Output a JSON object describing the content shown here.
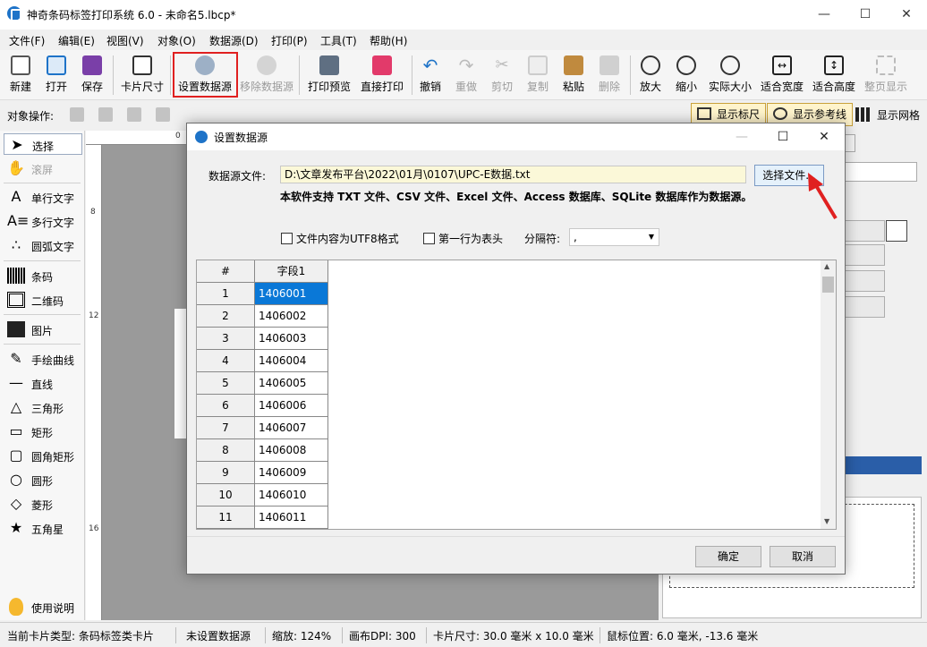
{
  "window": {
    "title": "神奇条码标签打印系统 6.0 - 未命名5.lbcp*",
    "minimize": "—",
    "maximize": "☐",
    "close": "✕"
  },
  "menu": [
    "文件(F)",
    "编辑(E)",
    "视图(V)",
    "对象(O)",
    "数据源(D)",
    "打印(P)",
    "工具(T)",
    "帮助(H)"
  ],
  "toolbar": {
    "new": "新建",
    "open": "打开",
    "save": "保存",
    "card_size": "卡片尺寸",
    "set_datasource": "设置数据源",
    "remove_datasource": "移除数据源",
    "print_preview": "打印预览",
    "direct_print": "直接打印",
    "undo": "撤销",
    "redo": "重做",
    "cut": "剪切",
    "copy": "复制",
    "paste": "粘贴",
    "delete": "删除",
    "zoom_in": "放大",
    "zoom_out": "缩小",
    "actual_size": "实际大小",
    "fit_width": "适合宽度",
    "fit_height": "适合高度",
    "fit_page": "整页显示"
  },
  "objbar": {
    "label": "对象操作:",
    "show_ruler": "显示标尺",
    "show_guides": "显示参考线",
    "show_grid": "显示网格"
  },
  "tools": {
    "select": "选择",
    "scroll": "滚屏",
    "single_text": "单行文字",
    "multi_text": "多行文字",
    "arc_text": "圆弧文字",
    "barcode": "条码",
    "qrcode": "二维码",
    "image": "图片",
    "freehand": "手绘曲线",
    "line": "直线",
    "triangle": "三角形",
    "rectangle": "矩形",
    "rounded_rect": "圆角矩形",
    "ellipse": "圆形",
    "diamond": "菱形",
    "star": "五角星",
    "help": "使用说明"
  },
  "ruler": {
    "h0": "0",
    "v8": "8",
    "v12": "12",
    "v16": "16"
  },
  "dialog": {
    "title": "设置数据源",
    "file_label": "数据源文件:",
    "file_path": "D:\\文章发布平台\\2022\\01月\\0107\\UPC-E数据.txt",
    "choose_file": "选择文件...",
    "notice": "本软件支持 TXT 文件、CSV 文件、Excel 文件、Access 数据库、SQLite 数据库作为数据源。",
    "utf8_label": "文件内容为UTF8格式",
    "header_label": "第一行为表头",
    "separator_label": "分隔符:",
    "separator_value": ",",
    "grid": {
      "col_hash": "#",
      "col_field1": "字段1",
      "rows": [
        {
          "n": "1",
          "v": "1406001"
        },
        {
          "n": "2",
          "v": "1406002"
        },
        {
          "n": "3",
          "v": "1406003"
        },
        {
          "n": "4",
          "v": "1406004"
        },
        {
          "n": "5",
          "v": "1406005"
        },
        {
          "n": "6",
          "v": "1406006"
        },
        {
          "n": "7",
          "v": "1406007"
        },
        {
          "n": "8",
          "v": "1406008"
        },
        {
          "n": "9",
          "v": "1406009"
        },
        {
          "n": "10",
          "v": "1406010"
        },
        {
          "n": "11",
          "v": "1406011"
        }
      ]
    },
    "ok": "确定",
    "cancel": "取消"
  },
  "status": {
    "card_type": "当前卡片类型: 条码标签类卡片",
    "datasource": "未设置数据源",
    "zoom": "缩放: 124%",
    "dpi": "画布DPI: 300",
    "card_size": "卡片尺寸: 30.0 毫米 x 10.0 毫米",
    "mouse_pos": "鼠标位置: 6.0 毫米, -13.6 毫米"
  },
  "colors": {
    "highlight_red": "#e02020",
    "selection_blue": "#0a78d7",
    "input_yellow": "#fbf8d8"
  }
}
